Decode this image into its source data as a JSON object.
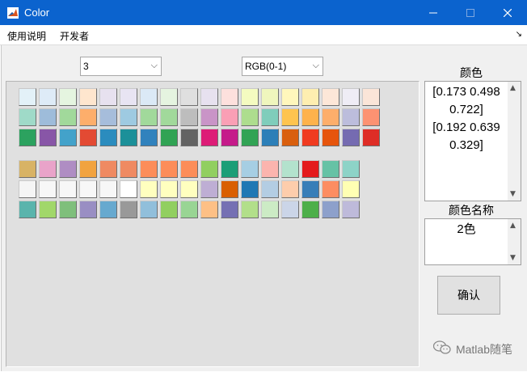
{
  "window": {
    "title": "Color"
  },
  "menu": {
    "items": [
      "使用说明",
      "开发者"
    ],
    "toolbar_toggle": "↘"
  },
  "controls": {
    "count_popup": {
      "value": "3",
      "arrow": "⌵"
    },
    "format_popup": {
      "value": "RGB(0-1)",
      "arrow": "⌵"
    }
  },
  "right": {
    "color_label": "颜色",
    "color_values": [
      "[0.173 0.498",
      "0.722]",
      "[0.192 0.639",
      "0.329]"
    ],
    "name_label": "颜色名称",
    "name_value": "2色",
    "confirm_label": "确认"
  },
  "watermark": {
    "text": "Matlab随笔"
  },
  "swatch_groups": [
    {
      "rows": [
        [
          "#e3f1f8",
          "#deebf7",
          "#e5f5e0",
          "#fee6ce",
          "#e7e1ef",
          "#e8e4f3",
          "#dbe9f6",
          "#e5f4e0",
          "#dfdfdf",
          "#e7e1ef",
          "#fde0dd",
          "#f4fbc0",
          "#eff6bd",
          "#fff7bc",
          "#feeeb0",
          "#fde7d8",
          "#efedf5",
          "#fbe5d8"
        ],
        [
          "#9fdac8",
          "#9ebcda",
          "#a1d99b",
          "#fdae6b",
          "#a6bddb",
          "#9ecae1",
          "#a1d99b",
          "#a1d99b",
          "#bdbdbd",
          "#c994c7",
          "#fa9fb5",
          "#addd8e",
          "#7fcdbb",
          "#fec44f",
          "#feb24c",
          "#fdae6b",
          "#bcbddc",
          "#fc9272"
        ],
        [
          "#2ca25f",
          "#8856a7",
          "#43a2ca",
          "#e34a33",
          "#2b8cbe",
          "#1c9099",
          "#3182bd",
          "#31a354",
          "#636363",
          "#dd1c77",
          "#c51b8a",
          "#31a354",
          "#2c7fb8",
          "#d95f0e",
          "#f03b20",
          "#e6550d",
          "#756bb1",
          "#de2d26"
        ]
      ]
    },
    {
      "rows": [
        [
          "#d8b365",
          "#e9a3c9",
          "#af8dc3",
          "#f1a340",
          "#ef8a62",
          "#ef8a62",
          "#fc8d59",
          "#fc8d59",
          "#fc8d59",
          "#91cf60",
          "#1b9e77",
          "#a6cee3",
          "#fbb4ae",
          "#b3e2cd",
          "#e41a1c",
          "#66c2a5",
          "#8dd3c7"
        ],
        [
          "#f5f5f5",
          "#f7f7f7",
          "#f7f7f7",
          "#f7f7f7",
          "#f7f7f7",
          "#ffffff",
          "#ffffbf",
          "#ffffbf",
          "#ffffbf",
          "#beaed4",
          "#d95f02",
          "#1f78b4",
          "#b3cde3",
          "#fdcdac",
          "#377eb8",
          "#fc8d62",
          "#ffffb3"
        ],
        [
          "#5ab4ac",
          "#a1d76a",
          "#7fbf7b",
          "#998ec3",
          "#67a9cf",
          "#999999",
          "#91bfdb",
          "#91cf60",
          "#99d594",
          "#fdc086",
          "#7570b3",
          "#b2df8a",
          "#ccebc5",
          "#cbd5e8",
          "#4daf4a",
          "#8da0cb",
          "#bebada"
        ]
      ]
    }
  ]
}
